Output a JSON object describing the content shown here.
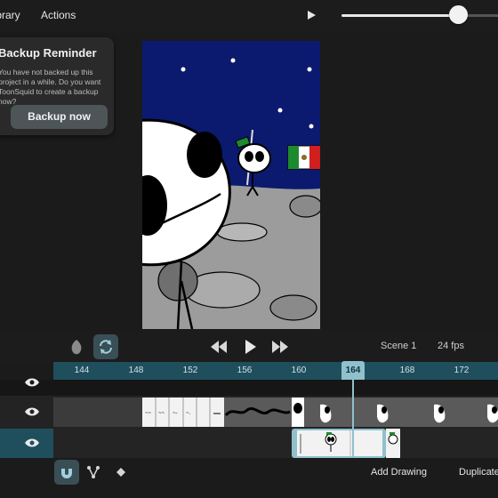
{
  "menu": {
    "library": "Library",
    "actions": "Actions"
  },
  "reminder": {
    "title": "Backup Reminder",
    "body": "You have not backed up this project in a while. Do you want ToonSquid to create a backup now?",
    "button": "Backup now"
  },
  "playback": {
    "scene": "Scene 1",
    "fps": "24 fps",
    "current_frame": "164"
  },
  "ruler": {
    "ticks": [
      "144",
      "148",
      "152",
      "156",
      "160",
      "164",
      "168",
      "172"
    ]
  },
  "bottom": {
    "add_drawing": "Add Drawing",
    "duplicate": "Duplicate"
  },
  "zoom_slider": {
    "value_fraction": 0.75
  },
  "colors": {
    "accent": "#8fc0cc",
    "ruler": "#1f4e5c",
    "sky": "#0b1a6e",
    "selected_row": "#1f4e5c"
  },
  "icons": [
    "play-icon",
    "onion-skin-icon",
    "loop-icon",
    "rewind-icon",
    "fast-forward-icon",
    "eye-icon",
    "magnet-icon",
    "branch-icon",
    "keyframe-diamond-icon"
  ]
}
